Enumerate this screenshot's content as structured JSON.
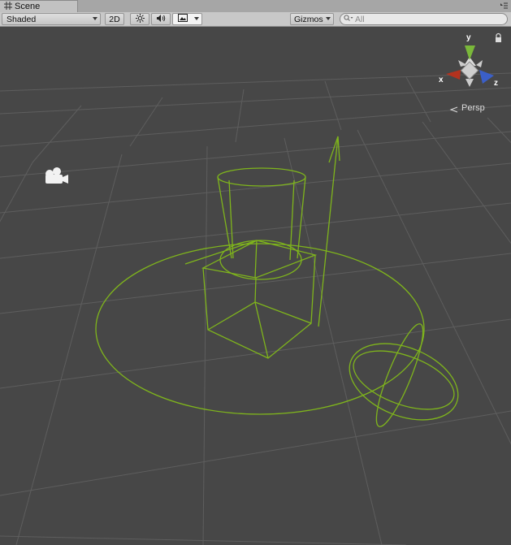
{
  "window": {
    "tab_title": "Scene"
  },
  "toolbar": {
    "shading_mode": "Shaded",
    "mode_2d": "2D",
    "gizmos_label": "Gizmos",
    "search_placeholder": "All"
  },
  "scene_gizmo": {
    "axis_y": "y",
    "axis_x": "x",
    "axis_z": "z",
    "projection_label": "Persp",
    "colors": {
      "x": "#b3321e",
      "y": "#7ab83a",
      "z": "#3b5fc8"
    }
  },
  "scene": {
    "background_color": "#474747",
    "grid_color": "#5c5c5c",
    "gizmo_wire_color": "#7fb51c",
    "icons": [
      "camera-icon"
    ]
  }
}
